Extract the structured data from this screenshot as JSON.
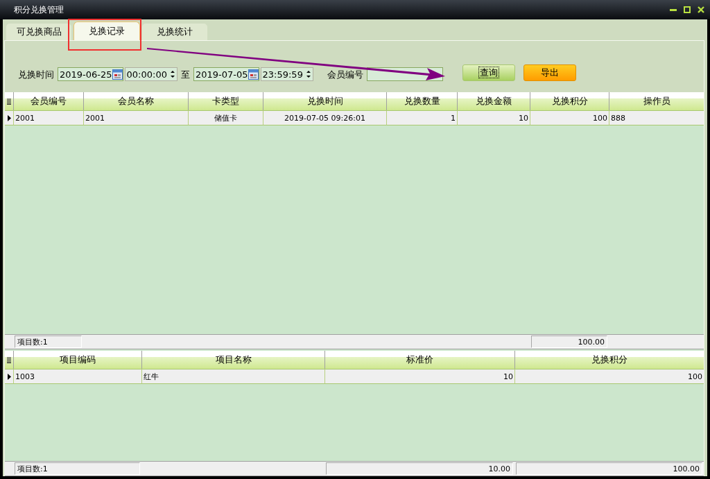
{
  "window": {
    "title": "积分兑换管理"
  },
  "tabs": [
    {
      "label": "可兑换商品",
      "selected": false
    },
    {
      "label": "兑换记录",
      "selected": true
    },
    {
      "label": "兑换统计",
      "selected": false
    }
  ],
  "filter": {
    "time_label": "兑换时间",
    "start_date": "2019-06-25",
    "start_time": "00:00:00",
    "separator": "至",
    "end_date": "2019-07-05",
    "end_time": "23:59:59",
    "member_label": "会员编号"
  },
  "buttons": [
    {
      "label": "查询",
      "kind": "query",
      "focused": true
    },
    {
      "label": "导出",
      "kind": "export",
      "focused": false
    }
  ],
  "records_table": {
    "columns": [
      {
        "label": "会员编号"
      },
      {
        "label": "会员名称"
      },
      {
        "label": "卡类型"
      },
      {
        "label": "兑换时间"
      },
      {
        "label": "兑换数量"
      },
      {
        "label": "兑换金额"
      },
      {
        "label": "兑换积分"
      },
      {
        "label": "操作员"
      }
    ],
    "rows": [
      {
        "selected": true,
        "cells": [
          "2001",
          "2001",
          "储值卡",
          "2019-07-05 09:26:01",
          "1",
          "10",
          "100",
          "888"
        ]
      }
    ],
    "footer": {
      "count": "项目数:1",
      "totals": [
        "100.00"
      ]
    }
  },
  "items_table": {
    "columns": [
      {
        "label": "项目编码"
      },
      {
        "label": "项目名称"
      },
      {
        "label": "标准价"
      },
      {
        "label": "兑换积分"
      }
    ],
    "rows": [
      {
        "selected": true,
        "cells": [
          "1003",
          "红牛",
          "10",
          "100"
        ]
      }
    ],
    "footer": {
      "count": "项目数:1",
      "totals": [
        "10.00",
        "100.00"
      ]
    }
  }
}
